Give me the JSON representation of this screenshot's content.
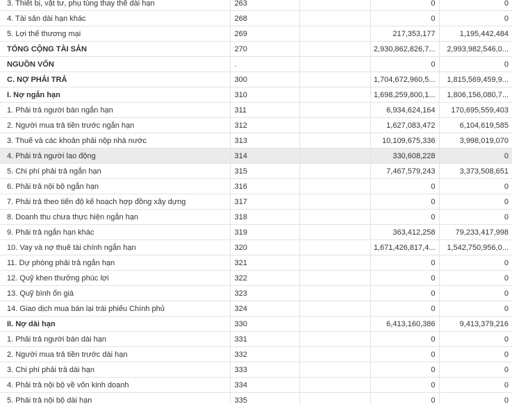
{
  "rows": [
    {
      "label": "3. Thiết bị, vật tư, phụ tùng thay thế dài hạn",
      "code": "263",
      "prev": "",
      "v1": "0",
      "v2": "0",
      "bold": false
    },
    {
      "label": "4. Tài sản dài hạn khác",
      "code": "268",
      "prev": "",
      "v1": "0",
      "v2": "0",
      "bold": false
    },
    {
      "label": "5. Lợi thế thương mại",
      "code": "269",
      "prev": "",
      "v1": "217,353,177",
      "v2": "1,195,442,484",
      "bold": false
    },
    {
      "label": "TỔNG CỘNG TÀI SẢN",
      "code": "270",
      "prev": "",
      "v1": "2,930,862,826,7...",
      "v2": "2,993,982,546,0...",
      "bold": true
    },
    {
      "label": "NGUỒN VỐN",
      "code": ".",
      "prev": "",
      "v1": "0",
      "v2": "0",
      "bold": true
    },
    {
      "label": "C. NỢ PHẢI TRẢ",
      "code": "300",
      "prev": "",
      "v1": "1,704,672,960,5...",
      "v2": "1,815,569,459,9...",
      "bold": true
    },
    {
      "label": "I. Nợ ngắn hạn",
      "code": "310",
      "prev": "",
      "v1": "1,698,259,800,1...",
      "v2": "1,806,156,080,7...",
      "bold": true
    },
    {
      "label": "1. Phải trả người bán ngắn hạn",
      "code": "311",
      "prev": "",
      "v1": "6,934,624,164",
      "v2": "170,695,559,403",
      "bold": false
    },
    {
      "label": "2. Người mua trả tiền trước ngắn hạn",
      "code": "312",
      "prev": "",
      "v1": "1,627,083,472",
      "v2": "6,104,619,585",
      "bold": false
    },
    {
      "label": "3. Thuế và các khoản phải nộp nhà nước",
      "code": "313",
      "prev": "",
      "v1": "10,109,675,336",
      "v2": "3,998,019,070",
      "bold": false
    },
    {
      "label": "4. Phải trả người lao động",
      "code": "314",
      "prev": "",
      "v1": "330,608,228",
      "v2": "0",
      "bold": false,
      "highlight": true
    },
    {
      "label": "5. Chi phí phải trả ngắn hạn",
      "code": "315",
      "prev": "",
      "v1": "7,467,579,243",
      "v2": "3,373,508,651",
      "bold": false
    },
    {
      "label": "6. Phải trả nội bộ ngắn hạn",
      "code": "316",
      "prev": "",
      "v1": "0",
      "v2": "0",
      "bold": false
    },
    {
      "label": "7. Phải trả theo tiến độ kế hoạch hợp đồng xây dựng",
      "code": "317",
      "prev": "",
      "v1": "0",
      "v2": "0",
      "bold": false
    },
    {
      "label": "8. Doanh thu chưa thực hiện ngắn hạn",
      "code": "318",
      "prev": "",
      "v1": "0",
      "v2": "0",
      "bold": false
    },
    {
      "label": "9. Phải trả ngắn hạn khác",
      "code": "319",
      "prev": "",
      "v1": "363,412,258",
      "v2": "79,233,417,998",
      "bold": false
    },
    {
      "label": "10. Vay và nợ thuê tài chính ngắn hạn",
      "code": "320",
      "prev": "",
      "v1": "1,671,426,817,4...",
      "v2": "1,542,750,956,0...",
      "bold": false
    },
    {
      "label": "11. Dự phòng phải trả ngắn hạn",
      "code": "321",
      "prev": "",
      "v1": "0",
      "v2": "0",
      "bold": false
    },
    {
      "label": "12. Quỹ khen thưởng phúc lợi",
      "code": "322",
      "prev": "",
      "v1": "0",
      "v2": "0",
      "bold": false
    },
    {
      "label": "13. Quỹ bình ổn giá",
      "code": "323",
      "prev": "",
      "v1": "0",
      "v2": "0",
      "bold": false
    },
    {
      "label": "14. Giao dịch mua bán lại trái phiếu Chính phủ",
      "code": "324",
      "prev": "",
      "v1": "0",
      "v2": "0",
      "bold": false
    },
    {
      "label": "II. Nợ dài hạn",
      "code": "330",
      "prev": "",
      "v1": "6,413,160,386",
      "v2": "9,413,379,216",
      "bold": true
    },
    {
      "label": "1. Phải trả người bán dài hạn",
      "code": "331",
      "prev": "",
      "v1": "0",
      "v2": "0",
      "bold": false
    },
    {
      "label": "2. Người mua trả tiền trước dài hạn",
      "code": "332",
      "prev": "",
      "v1": "0",
      "v2": "0",
      "bold": false
    },
    {
      "label": "3. Chi phí phải trả dài hạn",
      "code": "333",
      "prev": "",
      "v1": "0",
      "v2": "0",
      "bold": false
    },
    {
      "label": "4. Phải trả nội bộ về vốn kinh doanh",
      "code": "334",
      "prev": "",
      "v1": "0",
      "v2": "0",
      "bold": false
    },
    {
      "label": "5. Phải trả nội bộ dài hạn",
      "code": "335",
      "prev": "",
      "v1": "0",
      "v2": "0",
      "bold": false
    }
  ]
}
